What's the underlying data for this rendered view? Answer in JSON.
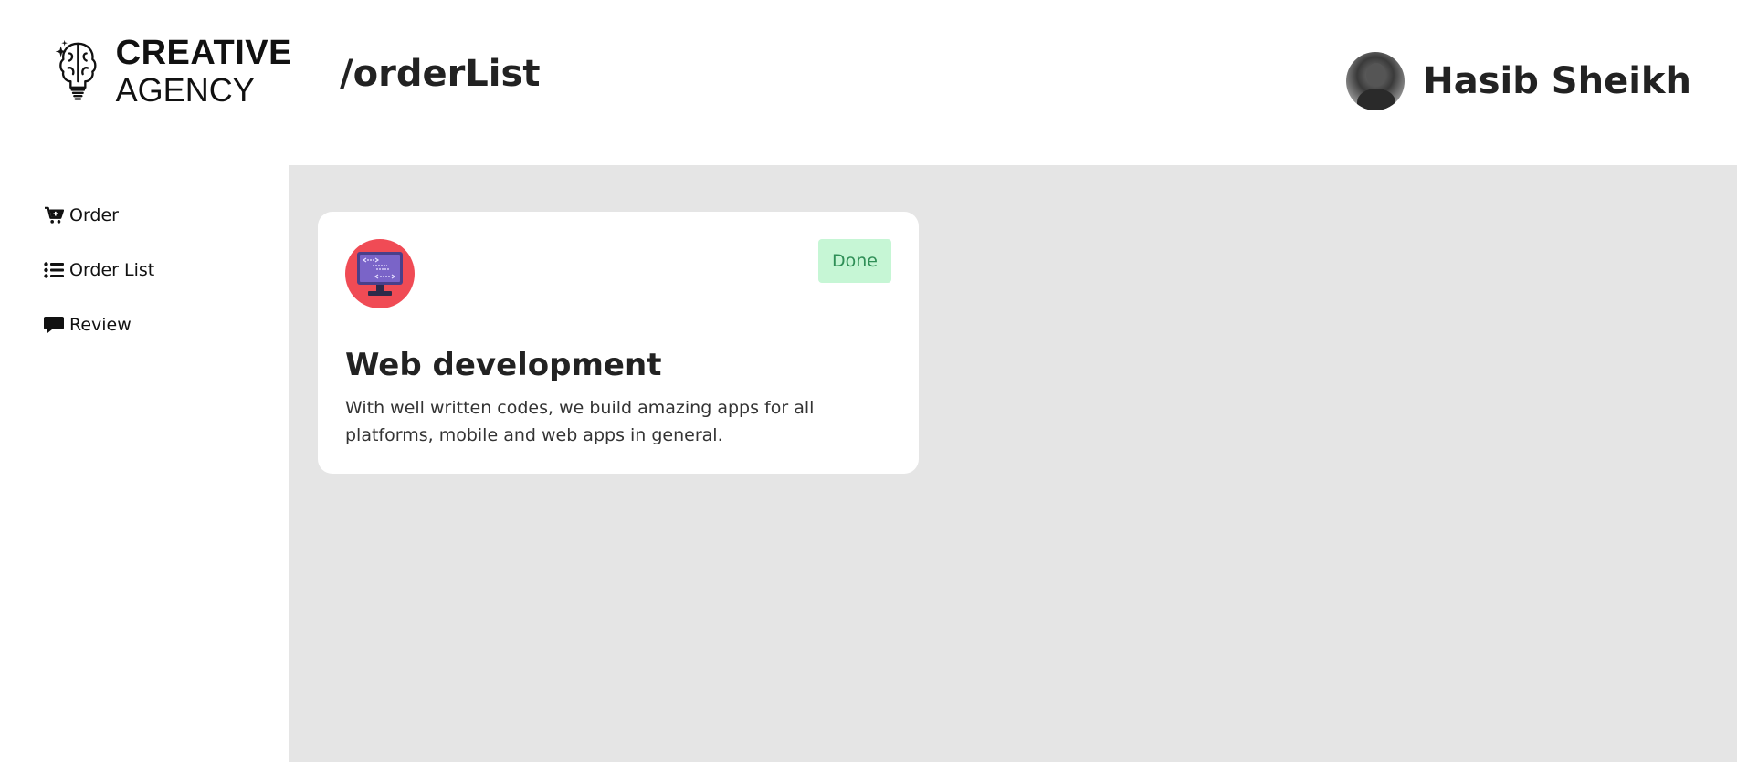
{
  "brand": {
    "line1": "CREATIVE",
    "line2": "AGENCY"
  },
  "header": {
    "path": "/orderList",
    "user_name": "Hasib Sheikh"
  },
  "sidebar": {
    "items": [
      {
        "label": "Order",
        "icon": "cart-plus-icon"
      },
      {
        "label": "Order List",
        "icon": "list-icon"
      },
      {
        "label": "Review",
        "icon": "comment-icon"
      }
    ]
  },
  "orders": [
    {
      "title": "Web development",
      "description": "With well written codes, we build amazing apps for all platforms, mobile and web apps in general.",
      "status": "Done",
      "icon": "web-development-monitor-icon"
    }
  ],
  "colors": {
    "main_bg": "#e5e5e5",
    "status_done_bg": "#c6f6d5",
    "status_done_text": "#2f8f57",
    "service_icon_bg": "#f04b55"
  }
}
